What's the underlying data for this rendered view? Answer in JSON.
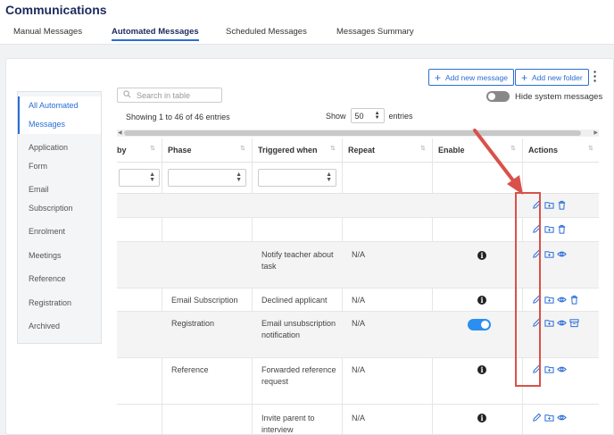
{
  "header": {
    "title": "Communications",
    "tabs": [
      {
        "label": "Manual Messages"
      },
      {
        "label": "Automated Messages"
      },
      {
        "label": "Scheduled Messages"
      },
      {
        "label": "Messages Summary"
      }
    ],
    "active_tab": "Automated Messages"
  },
  "toolbar": {
    "add_message_label": "Add new message",
    "add_folder_label": "Add new folder",
    "hide_system_label": "Hide system messages"
  },
  "sidebar": {
    "items": [
      {
        "label1": "All Automated",
        "label2": "Messages"
      },
      {
        "label1": "Application",
        "label2": "Form"
      },
      {
        "label1": "Email",
        "label2": "Subscription"
      },
      {
        "label1": "Enrolment"
      },
      {
        "label1": "Meetings"
      },
      {
        "label1": "Reference"
      },
      {
        "label1": "Registration"
      },
      {
        "label1": "Archived"
      }
    ]
  },
  "search": {
    "placeholder": "Search in table"
  },
  "info": {
    "showing": "Showing 1 to 46 of 46 entries",
    "show_label": "Show",
    "page_length": "50",
    "entries_label": "entries"
  },
  "table": {
    "columns": [
      "by",
      "Phase",
      "Triggered when",
      "Repeat",
      "Enable",
      "Actions"
    ],
    "rows": [
      {
        "phase": "",
        "trig1": "",
        "trig2": "",
        "repeat": "",
        "enable": "",
        "actions": [
          "edit-icon",
          "folder-plus-icon",
          "trash-icon"
        ]
      },
      {
        "phase": "",
        "trig1": "",
        "trig2": "",
        "repeat": "",
        "enable": "",
        "actions": [
          "edit-icon",
          "folder-plus-icon",
          "trash-icon"
        ]
      },
      {
        "phase": "",
        "trig1": "Notify teacher about",
        "trig2": "task",
        "repeat": "N/A",
        "enable": "info",
        "actions": [
          "edit-icon",
          "folder-plus-icon",
          "eye-icon"
        ]
      },
      {
        "phase": "Email Subscription",
        "trig1": "Declined applicant",
        "trig2": "",
        "repeat": "N/A",
        "enable": "info",
        "actions": [
          "edit-icon",
          "folder-plus-icon",
          "eye-icon",
          "trash-icon"
        ]
      },
      {
        "phase": "Registration",
        "trig1": "Email unsubscription",
        "trig2": "notification",
        "repeat": "N/A",
        "enable": "toggle",
        "actions": [
          "edit-icon",
          "folder-plus-icon",
          "eye-icon",
          "archive-icon"
        ]
      },
      {
        "phase": "Reference",
        "trig1": "Forwarded reference",
        "trig2": "request",
        "repeat": "N/A",
        "enable": "info",
        "actions": [
          "edit-icon",
          "folder-plus-icon",
          "eye-icon"
        ]
      },
      {
        "phase": "",
        "trig1": "Invite parent to",
        "trig2": "interview",
        "repeat": "N/A",
        "enable": "info",
        "actions": [
          "edit-icon",
          "folder-plus-icon",
          "eye-icon"
        ]
      }
    ]
  },
  "colors": {
    "accent": "#2a6ed6",
    "highlight": "#d9514a",
    "title": "#1f2a5c"
  }
}
